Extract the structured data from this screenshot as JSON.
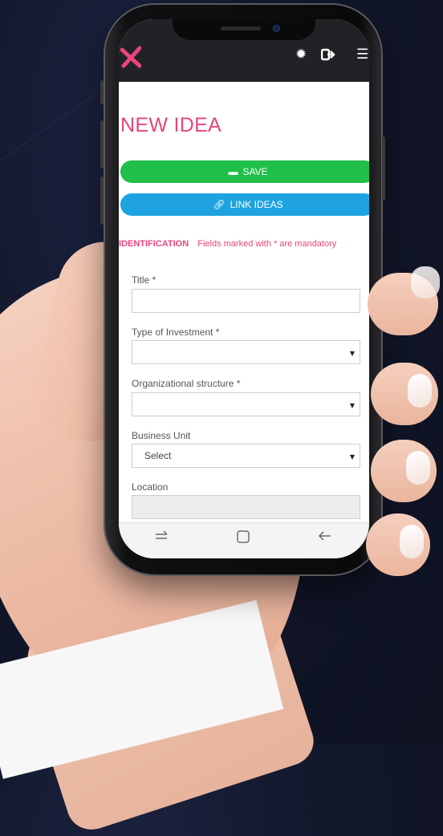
{
  "app": {
    "page_title": "NEW IDEA",
    "buttons": {
      "save": "SAVE",
      "link": "LINK IDEAS"
    },
    "section": {
      "title": "IDENTIFICATION",
      "note": "Fields marked with * are mandatory"
    },
    "fields": [
      {
        "label": "Title *",
        "type": "text",
        "value": ""
      },
      {
        "label": "Type of Investment *",
        "type": "select",
        "value": ""
      },
      {
        "label": "Organizational structure *",
        "type": "select",
        "value": ""
      },
      {
        "label": "Business Unit",
        "type": "select",
        "value": "Select"
      },
      {
        "label": "Location",
        "type": "text-disabled",
        "value": ""
      }
    ]
  },
  "colors": {
    "accent": "#e8457d",
    "save_button": "#1fbf4a",
    "link_button": "#1ea3e0",
    "appbar": "#222226"
  },
  "icons": {
    "logo": "x-logo-icon",
    "settings": "gear-icon",
    "logout": "logout-icon",
    "menu": "hamburger-menu-icon",
    "save": "floppy-disk-icon",
    "link": "chain-link-icon",
    "nav_recents": "recents-icon",
    "nav_home": "home-icon",
    "nav_back": "back-icon"
  }
}
